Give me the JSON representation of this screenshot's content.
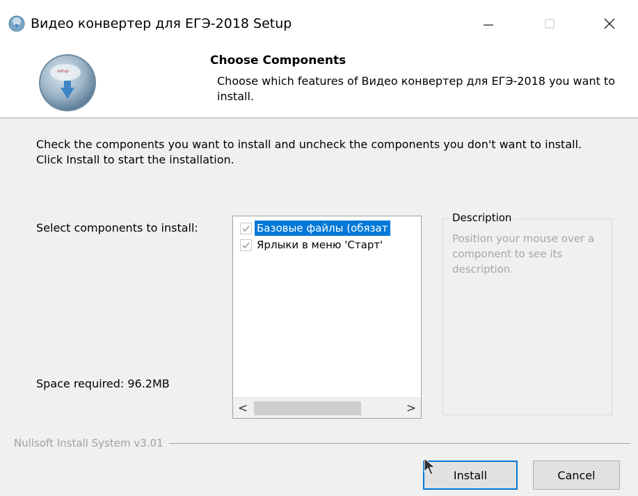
{
  "window": {
    "title": "Видео конвертер для ЕГЭ-2018 Setup",
    "controls": {
      "minimize": "—",
      "maximize": "☐",
      "close": "✕"
    }
  },
  "header": {
    "title": "Choose Components",
    "description": "Choose which features of Видео конвертер для ЕГЭ-2018 you want to install."
  },
  "intro_text": "Check the components you want to install and uncheck the components you don't want to install. Click Install to start the installation.",
  "select_label": "Select components to install:",
  "components": [
    {
      "label": "Базовые файлы (обязат",
      "checked": true,
      "selected": true
    },
    {
      "label": "Ярлыки в меню 'Старт'",
      "checked": true,
      "selected": false
    }
  ],
  "scrollbar": {
    "left_arrow": "<",
    "right_arrow": ">"
  },
  "description": {
    "legend": "Description",
    "text": "Position your mouse over a component to see its description."
  },
  "space_required": "Space required: 96.2MB",
  "branding": "Nullsoft Install System v3.01",
  "buttons": {
    "install": "Install",
    "cancel": "Cancel"
  },
  "colors": {
    "selection": "#0078d7",
    "disabled_text": "#a6a6a6"
  }
}
